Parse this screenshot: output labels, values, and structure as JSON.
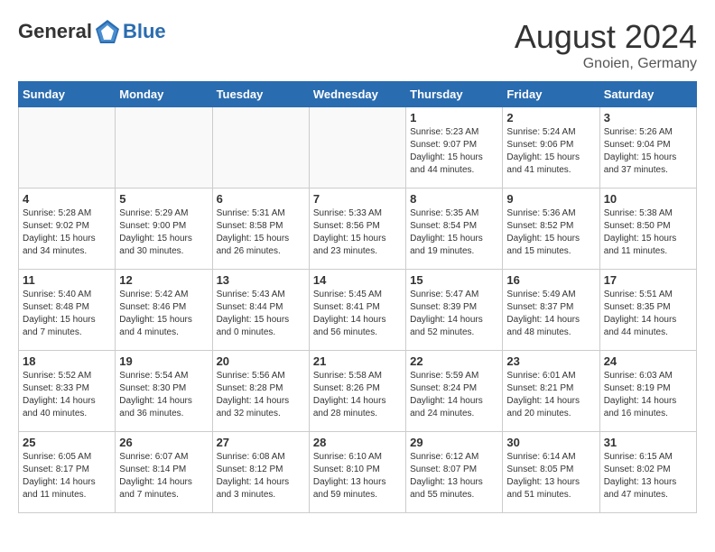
{
  "header": {
    "logo_general": "General",
    "logo_blue": "Blue",
    "month_year": "August 2024",
    "location": "Gnoien, Germany"
  },
  "weekdays": [
    "Sunday",
    "Monday",
    "Tuesday",
    "Wednesday",
    "Thursday",
    "Friday",
    "Saturday"
  ],
  "weeks": [
    [
      {
        "day": "",
        "empty": true
      },
      {
        "day": "",
        "empty": true
      },
      {
        "day": "",
        "empty": true
      },
      {
        "day": "",
        "empty": true
      },
      {
        "day": "1",
        "sunrise": "5:23 AM",
        "sunset": "9:07 PM",
        "daylight": "15 hours and 44 minutes."
      },
      {
        "day": "2",
        "sunrise": "5:24 AM",
        "sunset": "9:06 PM",
        "daylight": "15 hours and 41 minutes."
      },
      {
        "day": "3",
        "sunrise": "5:26 AM",
        "sunset": "9:04 PM",
        "daylight": "15 hours and 37 minutes."
      }
    ],
    [
      {
        "day": "4",
        "sunrise": "5:28 AM",
        "sunset": "9:02 PM",
        "daylight": "15 hours and 34 minutes."
      },
      {
        "day": "5",
        "sunrise": "5:29 AM",
        "sunset": "9:00 PM",
        "daylight": "15 hours and 30 minutes."
      },
      {
        "day": "6",
        "sunrise": "5:31 AM",
        "sunset": "8:58 PM",
        "daylight": "15 hours and 26 minutes."
      },
      {
        "day": "7",
        "sunrise": "5:33 AM",
        "sunset": "8:56 PM",
        "daylight": "15 hours and 23 minutes."
      },
      {
        "day": "8",
        "sunrise": "5:35 AM",
        "sunset": "8:54 PM",
        "daylight": "15 hours and 19 minutes."
      },
      {
        "day": "9",
        "sunrise": "5:36 AM",
        "sunset": "8:52 PM",
        "daylight": "15 hours and 15 minutes."
      },
      {
        "day": "10",
        "sunrise": "5:38 AM",
        "sunset": "8:50 PM",
        "daylight": "15 hours and 11 minutes."
      }
    ],
    [
      {
        "day": "11",
        "sunrise": "5:40 AM",
        "sunset": "8:48 PM",
        "daylight": "15 hours and 7 minutes."
      },
      {
        "day": "12",
        "sunrise": "5:42 AM",
        "sunset": "8:46 PM",
        "daylight": "15 hours and 4 minutes."
      },
      {
        "day": "13",
        "sunrise": "5:43 AM",
        "sunset": "8:44 PM",
        "daylight": "15 hours and 0 minutes."
      },
      {
        "day": "14",
        "sunrise": "5:45 AM",
        "sunset": "8:41 PM",
        "daylight": "14 hours and 56 minutes."
      },
      {
        "day": "15",
        "sunrise": "5:47 AM",
        "sunset": "8:39 PM",
        "daylight": "14 hours and 52 minutes."
      },
      {
        "day": "16",
        "sunrise": "5:49 AM",
        "sunset": "8:37 PM",
        "daylight": "14 hours and 48 minutes."
      },
      {
        "day": "17",
        "sunrise": "5:51 AM",
        "sunset": "8:35 PM",
        "daylight": "14 hours and 44 minutes."
      }
    ],
    [
      {
        "day": "18",
        "sunrise": "5:52 AM",
        "sunset": "8:33 PM",
        "daylight": "14 hours and 40 minutes."
      },
      {
        "day": "19",
        "sunrise": "5:54 AM",
        "sunset": "8:30 PM",
        "daylight": "14 hours and 36 minutes."
      },
      {
        "day": "20",
        "sunrise": "5:56 AM",
        "sunset": "8:28 PM",
        "daylight": "14 hours and 32 minutes."
      },
      {
        "day": "21",
        "sunrise": "5:58 AM",
        "sunset": "8:26 PM",
        "daylight": "14 hours and 28 minutes."
      },
      {
        "day": "22",
        "sunrise": "5:59 AM",
        "sunset": "8:24 PM",
        "daylight": "14 hours and 24 minutes."
      },
      {
        "day": "23",
        "sunrise": "6:01 AM",
        "sunset": "8:21 PM",
        "daylight": "14 hours and 20 minutes."
      },
      {
        "day": "24",
        "sunrise": "6:03 AM",
        "sunset": "8:19 PM",
        "daylight": "14 hours and 16 minutes."
      }
    ],
    [
      {
        "day": "25",
        "sunrise": "6:05 AM",
        "sunset": "8:17 PM",
        "daylight": "14 hours and 11 minutes."
      },
      {
        "day": "26",
        "sunrise": "6:07 AM",
        "sunset": "8:14 PM",
        "daylight": "14 hours and 7 minutes."
      },
      {
        "day": "27",
        "sunrise": "6:08 AM",
        "sunset": "8:12 PM",
        "daylight": "14 hours and 3 minutes."
      },
      {
        "day": "28",
        "sunrise": "6:10 AM",
        "sunset": "8:10 PM",
        "daylight": "13 hours and 59 minutes."
      },
      {
        "day": "29",
        "sunrise": "6:12 AM",
        "sunset": "8:07 PM",
        "daylight": "13 hours and 55 minutes."
      },
      {
        "day": "30",
        "sunrise": "6:14 AM",
        "sunset": "8:05 PM",
        "daylight": "13 hours and 51 minutes."
      },
      {
        "day": "31",
        "sunrise": "6:15 AM",
        "sunset": "8:02 PM",
        "daylight": "13 hours and 47 minutes."
      }
    ]
  ]
}
